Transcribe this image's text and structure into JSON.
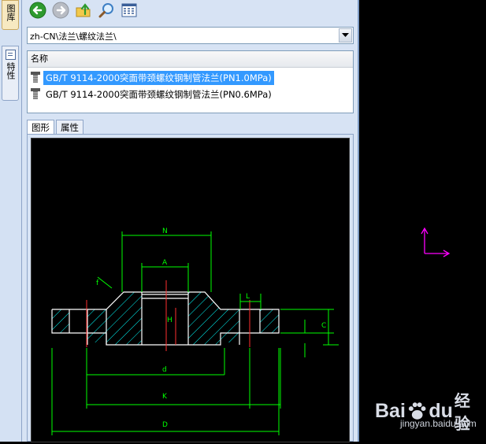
{
  "side_tabs": [
    {
      "label": "图库"
    },
    {
      "label": "特性"
    }
  ],
  "toolbar": {
    "buttons": [
      {
        "name": "back",
        "icon": "back-arrow-icon"
      },
      {
        "name": "forward",
        "icon": "forward-arrow-icon"
      },
      {
        "name": "up-folder",
        "icon": "folder-up-icon"
      },
      {
        "name": "search",
        "icon": "magnifier-icon"
      },
      {
        "name": "view",
        "icon": "grid-view-icon"
      }
    ]
  },
  "path": {
    "value": "zh-CN\\法兰\\螺纹法兰\\"
  },
  "list": {
    "header": "名称",
    "items": [
      {
        "label": "GB/T 9114-2000突面带颈螺纹钢制管法兰(PN1.0MPa)",
        "selected": true
      },
      {
        "label": "GB/T 9114-2000突面带颈螺纹钢制管法兰(PN0.6MPa)",
        "selected": false
      }
    ]
  },
  "preview_tabs": [
    {
      "label": "图形",
      "active": true
    },
    {
      "label": "属性",
      "active": false
    }
  ],
  "drawing": {
    "dim_labels": [
      "N",
      "A",
      "H",
      "L",
      "C",
      "f",
      "d",
      "K",
      "D"
    ]
  },
  "watermark": {
    "logo": "Bai",
    "logo2": "du",
    "logo_cn": "经验",
    "url": "jingyan.baidu.com"
  },
  "colors": {
    "panel_bg": "#d7e3f4",
    "selection": "#3399ff",
    "drawing_lines": "#ffffff",
    "dimension_lines": "#00ff00",
    "center_lines": "#ff0000",
    "hatch": "#00ffff",
    "ucs": "#ff00ff"
  }
}
